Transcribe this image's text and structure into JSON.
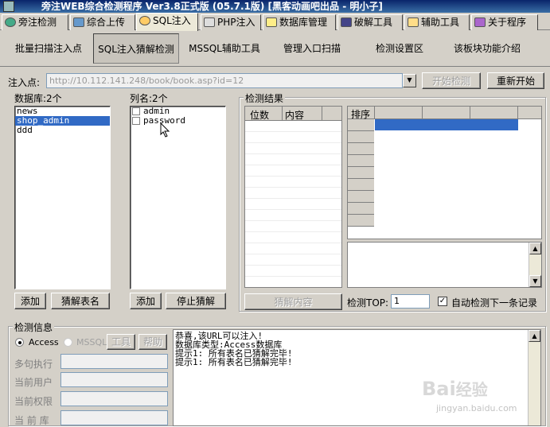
{
  "window": {
    "title": "旁注WEB综合检测程序 Ver3.8正式版 (05.7.1版) [黑客动画吧出品 - 明小子]"
  },
  "tabs": [
    {
      "label": "旁注检测",
      "icon": "globe-icon"
    },
    {
      "label": "综合上传",
      "icon": "upload-icon"
    },
    {
      "label": "SQL注入",
      "icon": "magnifier-icon"
    },
    {
      "label": "PHP注入",
      "icon": "php-icon"
    },
    {
      "label": "数据库管理",
      "icon": "database-icon"
    },
    {
      "label": "破解工具",
      "icon": "keyboard-icon"
    },
    {
      "label": "辅助工具",
      "icon": "clipboard-icon"
    },
    {
      "label": "关于程序",
      "icon": "book-icon"
    }
  ],
  "subnav": [
    "批量扫描注入点",
    "SQL注入猜解检测",
    "MSSQL辅助工具",
    "管理入口扫描",
    "检测设置区",
    "该板块功能介绍"
  ],
  "url": {
    "label": "注入点:",
    "value": "http://10.112.141.248/book/book.asp?id=12",
    "start_button": "开始检测",
    "restart_button": "重新开始"
  },
  "database": {
    "label": "数据库:2个",
    "items": [
      "news",
      "shop_admin",
      "ddd"
    ],
    "selected": 1,
    "add_button": "添加",
    "guess_button": "猜解表名"
  },
  "columns": {
    "label": "列名:2个",
    "items": [
      "admin",
      "password"
    ],
    "add_button": "添加",
    "stop_button": "停止猜解"
  },
  "results": {
    "label": "检测结果",
    "col_pos": "位数",
    "col_content": "内容",
    "sort_header": "排序",
    "guess_content_button": "猜解内容",
    "top_label": "检测TOP:",
    "top_value": "1",
    "auto_label": "自动检测下一条记录",
    "auto_checked": true
  },
  "info": {
    "label": "检测信息",
    "radio_access": "Access",
    "radio_mssql": "MSSQL",
    "btn_tool": "工具",
    "btn_help": "帮助",
    "fields": [
      "多句执行",
      "当前用户",
      "当前权限",
      "当 前 库"
    ],
    "log": [
      "恭喜,该URL可以注入!",
      "数据库类型:Access数据库",
      "提示1: 所有表名已猜解完毕!",
      "提示1: 所有表名已猜解完毕!"
    ]
  },
  "watermark": {
    "line1": "Bai",
    "line2": "经验",
    "line3": "jingyan.baidu.com"
  }
}
